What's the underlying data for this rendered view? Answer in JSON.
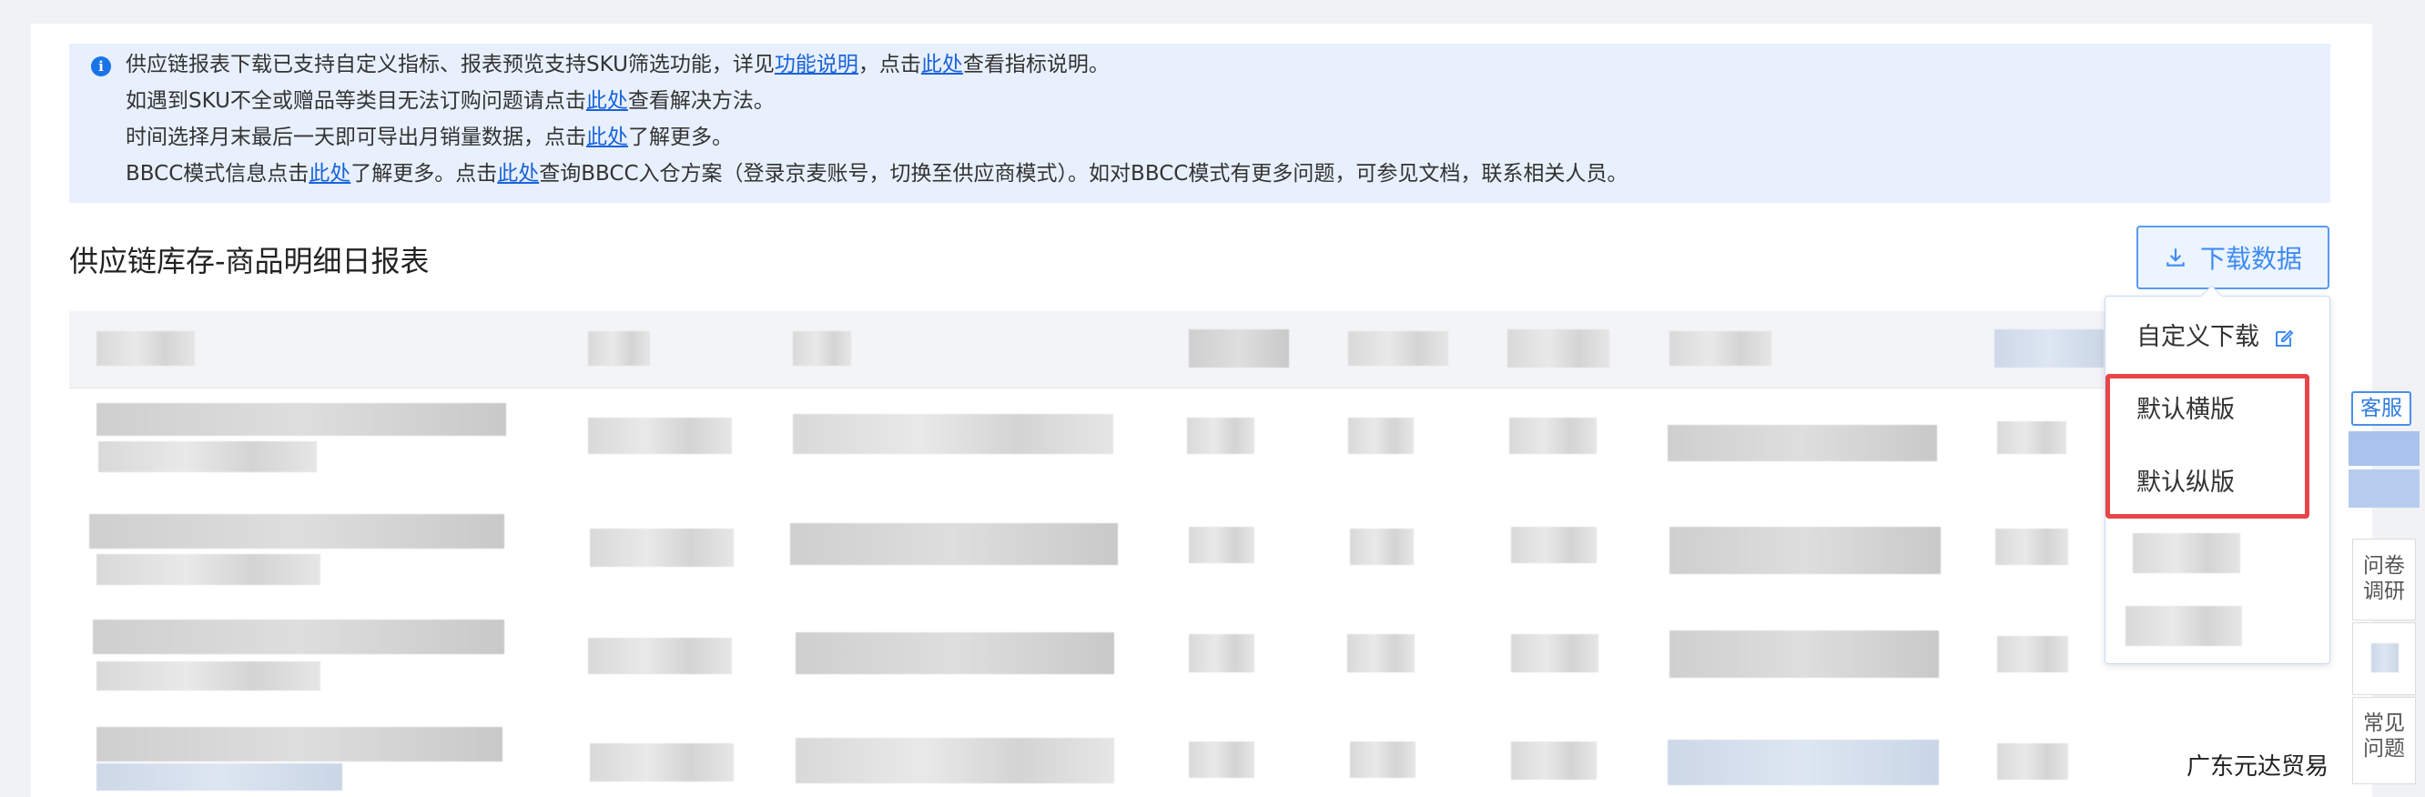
{
  "notice": {
    "line1_pre": "供应链报表下载已支持自定义指标、报表预览支持SKU筛选功能，详见",
    "line1_link1": "功能说明",
    "line1_mid": "，点击",
    "line1_link2": "此处",
    "line1_post": "查看指标说明。",
    "line2_pre": "如遇到SKU不全或赠品等类目无法订购问题请点击",
    "line2_link": "此处",
    "line2_post": "查看解决方法。",
    "line3_pre": "时间选择月末最后一天即可导出月销量数据，点击",
    "line3_link": "此处",
    "line3_post": "了解更多。",
    "line4_pre": "BBCC模式信息点击",
    "line4_link1": "此处",
    "line4_mid": "了解更多。点击",
    "line4_link2": "此处",
    "line4_post": "查询BBCC入仓方案（登录京麦账号，切换至供应商模式）。如对BBCC模式有更多问题，可参见文档，联系相关人员。"
  },
  "page_title": "供应链库存-商品明细日报表",
  "download_button": "下载数据",
  "dropdown": {
    "custom_download": "自定义下载",
    "default_landscape": "默认横版",
    "default_portrait": "默认纵版"
  },
  "side_toolbar": {
    "customer_service": "客服",
    "survey_line1": "问卷",
    "survey_line2": "调研",
    "faq_line1": "常见",
    "faq_line2": "问题"
  },
  "partial_text": {
    "row3_tail": "广东元达贸易"
  },
  "colors": {
    "link": "#1a63d9",
    "primary": "#3f8bf3",
    "highlight": "#e84549",
    "notice_bg": "#e8f0fd"
  },
  "icons": {
    "info": "info-icon",
    "download": "download-icon",
    "edit": "edit-icon"
  }
}
